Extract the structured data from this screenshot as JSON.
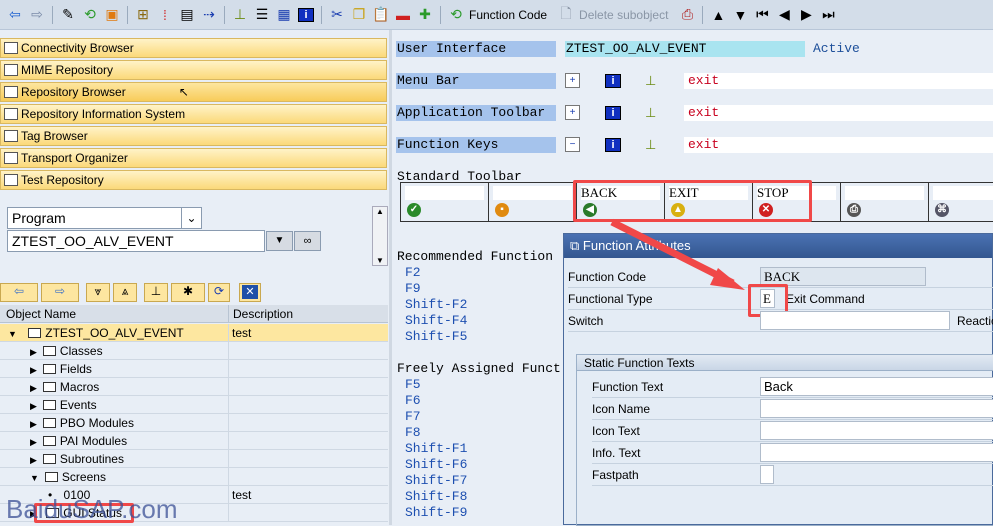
{
  "toolbar": {
    "icons": [
      "back-icon",
      "forward-icon",
      "edit-icon",
      "activate-icon",
      "other-object-icon",
      "where-used-icon",
      "magic-wand-icon",
      "display-object-list-icon",
      "navigation-icon",
      "hierarchy-icon",
      "stack-icon",
      "list-icon",
      "info-icon",
      "cut-icon",
      "copy-icon",
      "paste-icon",
      "delete-icon",
      "insert-icon",
      "function-code-icon"
    ],
    "function_code": "Function Code",
    "delete_subobject": "Delete subobject"
  },
  "nav": [
    "Connectivity Browser",
    "MIME Repository",
    "Repository Browser",
    "Repository Information System",
    "Tag Browser",
    "Transport Organizer",
    "Test Repository"
  ],
  "selector": {
    "type": "Program",
    "name": "ZTEST_OO_ALV_EVENT"
  },
  "tree": {
    "headers": [
      "Object Name",
      "Description"
    ],
    "root": {
      "name": "ZTEST_OO_ALV_EVENT",
      "desc": "test"
    },
    "children": [
      "Classes",
      "Fields",
      "Macros",
      "Events",
      "PBO Modules",
      "PAI Modules",
      "Subroutines",
      "Screens"
    ],
    "screen": {
      "name": "0100",
      "desc": "test"
    },
    "gui_status": "GUI Status"
  },
  "watermark": "BaiduSAP.com",
  "editor": {
    "ui_label": "User Interface",
    "ui_value": "ZTEST_OO_ALV_EVENT",
    "status": "Active",
    "rows": [
      {
        "label": "Menu Bar",
        "value": "exit"
      },
      {
        "label": "Application Toolbar",
        "value": "exit"
      },
      {
        "label": "Function Keys",
        "value": "exit"
      }
    ],
    "std_toolbar_label": "Standard Toolbar",
    "std_buttons": [
      "",
      "",
      "BACK",
      "EXIT",
      "STOP",
      "",
      ""
    ],
    "recommended_label": "Recommended Function",
    "recommended": [
      "F2",
      "F9",
      "Shift-F2",
      "Shift-F4",
      "Shift-F5"
    ],
    "free_label": "Freely Assigned Funct",
    "free": [
      "F5",
      "F6",
      "F7",
      "F8",
      "Shift-F1",
      "Shift-F6",
      "Shift-F7",
      "Shift-F8",
      "Shift-F9"
    ]
  },
  "dialog": {
    "title": "Function Attributes",
    "function_code_label": "Function Code",
    "function_code": "BACK",
    "functional_type_label": "Functional Type",
    "functional_type": "E",
    "functional_type_desc": "Exit Command",
    "switch_label": "Switch",
    "reaction_label": "Reaction",
    "group_title": "Static Function Texts",
    "function_text_label": "Function Text",
    "function_text": "Back",
    "icon_name_label": "Icon Name",
    "icon_text_label": "Icon Text",
    "info_text_label": "Info. Text",
    "fastpath_label": "Fastpath"
  },
  "colors": {
    "highlight": "#f04848",
    "label_bg": "#a5c3ec",
    "active_field": "#a9e4f0",
    "nav_button": "#fbd97a"
  }
}
